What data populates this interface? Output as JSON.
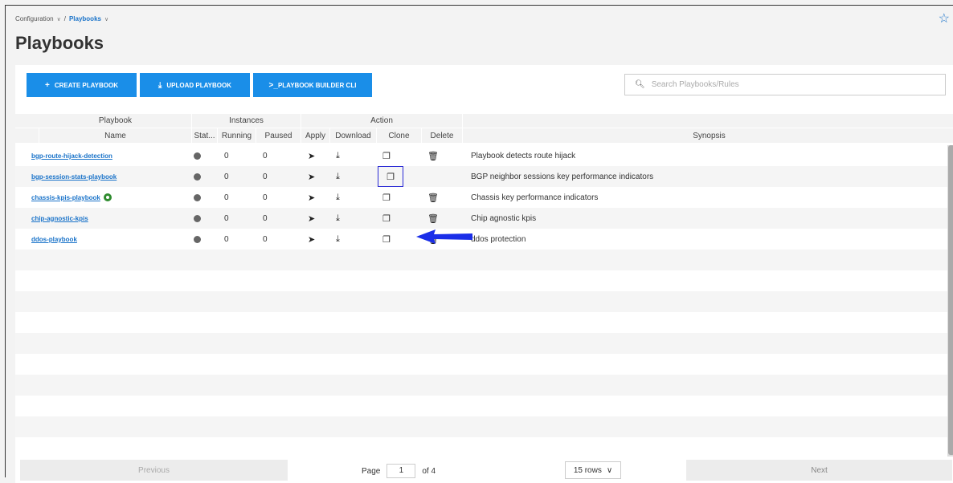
{
  "breadcrumb": {
    "parent": "Configuration",
    "current": "Playbooks"
  },
  "page_title": "Playbooks",
  "toolbar": {
    "create_label": "CREATE PLAYBOOK",
    "upload_label": "UPLOAD PLAYBOOK",
    "cli_label": "PLAYBOOK BUILDER CLI",
    "cli_prefix": ">_"
  },
  "search": {
    "placeholder": "Search Playbooks/Rules"
  },
  "table": {
    "group_headers": {
      "playbook": "Playbook",
      "instances": "Instances",
      "action": "Action"
    },
    "columns": {
      "name": "Name",
      "status": "Stat...",
      "running": "Running",
      "paused": "Paused",
      "apply": "Apply",
      "download": "Download",
      "clone": "Clone",
      "delete": "Delete",
      "synopsis": "Synopsis"
    },
    "rows": [
      {
        "name": "bgp-route-hijack-detection",
        "running": "0",
        "paused": "0",
        "synopsis": "Playbook detects route hijack"
      },
      {
        "name": "bgp-session-stats-playbook",
        "running": "0",
        "paused": "0",
        "synopsis": "BGP neighbor sessions key performance indicators"
      },
      {
        "name": "chassis-kpis-playbook",
        "running": "0",
        "paused": "0",
        "synopsis": "Chassis key performance indicators"
      },
      {
        "name": "chip-agnostic-kpis",
        "running": "0",
        "paused": "0",
        "synopsis": "Chip agnostic kpis"
      },
      {
        "name": "ddos-playbook",
        "running": "0",
        "paused": "0",
        "synopsis": "ddos protection"
      }
    ]
  },
  "pagination": {
    "previous": "Previous",
    "page_label": "Page",
    "page": "1",
    "of": "of 4",
    "rows": "15 rows",
    "next": "Next"
  },
  "colors": {
    "accent": "#1a8ee8",
    "link": "#1a73c9",
    "arrow": "#1a2ee8"
  }
}
